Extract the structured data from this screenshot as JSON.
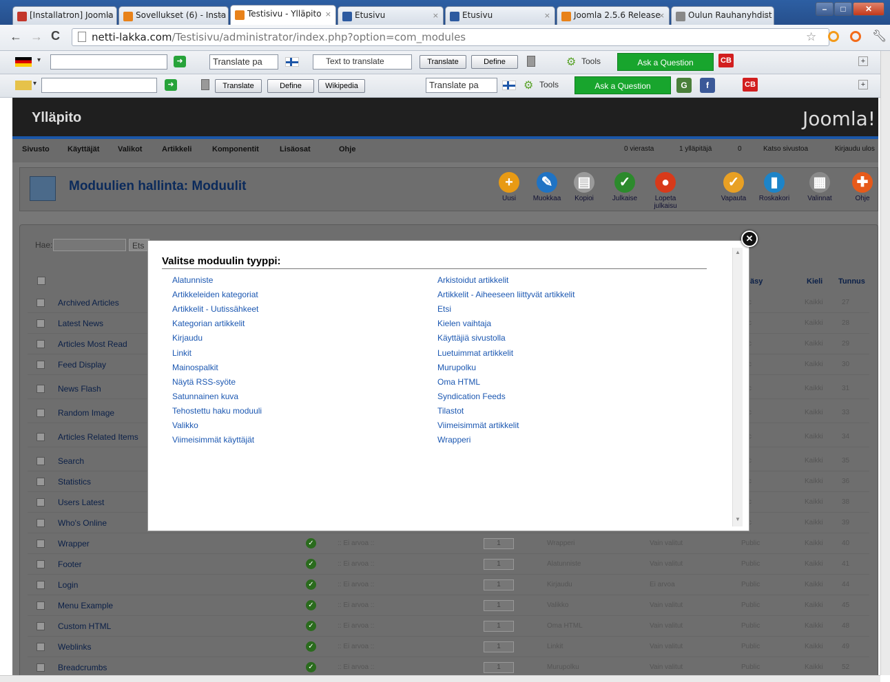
{
  "browser": {
    "tabs": [
      {
        "label": "[Installatron] Joomla",
        "color": "#c3362b"
      },
      {
        "label": "Sovellukset (6) - Insta",
        "color": "#e8821a"
      },
      {
        "label": "Testisivu - Ylläpito",
        "color": "#e8821a"
      },
      {
        "label": "Etusivu",
        "color": "#2d5aa0"
      },
      {
        "label": "Etusivu",
        "color": "#2d5aa0"
      },
      {
        "label": "Joomla 2.5.6 Release",
        "color": "#e8821a"
      },
      {
        "label": "Oulun Rauhanyhdist",
        "color": "#888888"
      }
    ],
    "url_host": "netti-lakka.com",
    "url_path": "/Testisivu/administrator/index.php?option=com_modules"
  },
  "toolbar1": {
    "translate_select": "Translate pa",
    "text_to_translate": "Text to translate",
    "translate": "Translate",
    "define": "Define",
    "tools": "Tools",
    "ask": "Ask a Question",
    "cb": "CB"
  },
  "toolbar2": {
    "translate": "Translate",
    "define": "Define",
    "wikipedia": "Wikipedia",
    "translate_select": "Translate pa",
    "tools": "Tools",
    "ask": "Ask a Question",
    "cb": "CB"
  },
  "joomla": {
    "header_title": "Ylläpito",
    "logo": "Joomla!",
    "menu": [
      "Sivusto",
      "Käyttäjät",
      "Valikot",
      "Artikkeli",
      "Komponentit",
      "Lisäosat",
      "Ohje"
    ],
    "status": {
      "visitors": "0 vierasta",
      "admins": "1 ylläpitäjä",
      "messages": "0",
      "view_site": "Katso sivustoa",
      "logout": "Kirjaudu ulos"
    },
    "page_title": "Moduulien hallinta: Moduulit",
    "tools": [
      "Uusi",
      "Muokkaa",
      "Kopioi",
      "Julkaise",
      "Lopeta julkaisu",
      "Vapauta",
      "Roskakori",
      "Valinnat",
      "Ohje"
    ],
    "search_label": "Hae:",
    "search_button": "Ets",
    "columns": {
      "access": "äsy",
      "language": "Kieli",
      "id": "Tunnus"
    },
    "rows": [
      {
        "name": "Archived Articles",
        "access": "blic",
        "lang": "Kaikki",
        "id": "27"
      },
      {
        "name": "Latest News",
        "access": "blic",
        "lang": "Kaikki",
        "id": "28"
      },
      {
        "name": "Articles Most Read",
        "access": "blic",
        "lang": "Kaikki",
        "id": "29"
      },
      {
        "name": "Feed Display",
        "access": "blic",
        "lang": "Kaikki",
        "id": "30"
      },
      {
        "name": "News Flash",
        "access": "blic",
        "lang": "Kaikki",
        "id": "31"
      },
      {
        "name": "Random Image",
        "access": "blic",
        "lang": "Kaikki",
        "id": "33"
      },
      {
        "name": "Articles Related Items",
        "access": "blic",
        "lang": "Kaikki",
        "id": "34"
      },
      {
        "name": "Search",
        "access": "blic",
        "lang": "Kaikki",
        "id": "35"
      },
      {
        "name": "Statistics",
        "access": "blic",
        "lang": "Kaikki",
        "id": "36"
      },
      {
        "name": "Users Latest",
        "access": "blic",
        "lang": "Kaikki",
        "id": "38"
      },
      {
        "name": "Who's Online",
        "access": "blic",
        "lang": "Kaikki",
        "id": "39"
      },
      {
        "name": "Wrapper",
        "status": "ok",
        "ea": ":: Ei arvoa ::",
        "order": "1",
        "type": "Wrapperi",
        "pages": "Vain valitut",
        "access": "Public",
        "lang": "Kaikki",
        "id": "40"
      },
      {
        "name": "Footer",
        "status": "ok",
        "ea": ":: Ei arvoa ::",
        "order": "1",
        "type": "Alatunniste",
        "pages": "Vain valitut",
        "access": "Public",
        "lang": "Kaikki",
        "id": "41"
      },
      {
        "name": "Login",
        "status": "ok",
        "ea": ":: Ei arvoa ::",
        "order": "1",
        "type": "Kirjaudu",
        "pages": "Ei arvoa",
        "access": "Public",
        "lang": "Kaikki",
        "id": "44"
      },
      {
        "name": "Menu Example",
        "status": "ok",
        "ea": ":: Ei arvoa ::",
        "order": "1",
        "type": "Valikko",
        "pages": "Vain valitut",
        "access": "Public",
        "lang": "Kaikki",
        "id": "45"
      },
      {
        "name": "Custom HTML",
        "status": "ok",
        "ea": ":: Ei arvoa ::",
        "order": "1",
        "type": "Oma HTML",
        "pages": "Vain valitut",
        "access": "Public",
        "lang": "Kaikki",
        "id": "48"
      },
      {
        "name": "Weblinks",
        "status": "ok",
        "ea": ":: Ei arvoa ::",
        "order": "1",
        "type": "Linkit",
        "pages": "Vain valitut",
        "access": "Public",
        "lang": "Kaikki",
        "id": "49"
      },
      {
        "name": "Breadcrumbs",
        "status": "ok",
        "ea": ":: Ei arvoa ::",
        "order": "1",
        "type": "Murupolku",
        "pages": "Vain valitut",
        "access": "Public",
        "lang": "Kaikki",
        "id": "52"
      }
    ]
  },
  "modal": {
    "title": "Valitse moduulin tyyppi:",
    "left": [
      "Alatunniste",
      "Artikkeleiden kategoriat",
      "Artikkelit - Uutissähkeet",
      "Kategorian artikkelit",
      "Kirjaudu",
      "Linkit",
      "Mainospalkit",
      "Näytä RSS-syöte",
      "Satunnainen kuva",
      "Tehostettu haku moduuli",
      "Valikko",
      "Viimeisimmät käyttäjät"
    ],
    "right": [
      "Arkistoidut artikkelit",
      "Artikkelit - Aiheeseen liittyvät artikkelit",
      "Etsi",
      "Kielen vaihtaja",
      "Käyttäjiä sivustolla",
      "Luetuimmat artikkelit",
      "Murupolku",
      "Oma HTML",
      "Syndication Feeds",
      "Tilastot",
      "Viimeisimmät artikkelit",
      "Wrapperi"
    ]
  }
}
